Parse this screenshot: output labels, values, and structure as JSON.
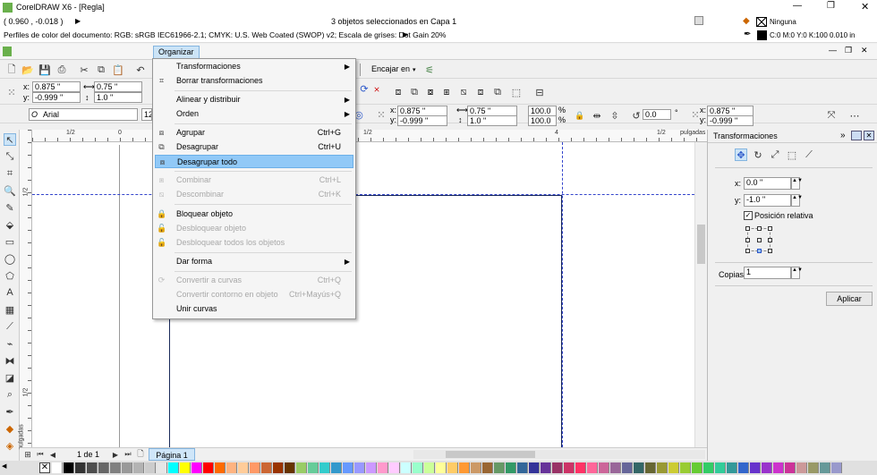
{
  "window": {
    "title": "CorelDRAW X6 - [Regla]",
    "status_center": "3 objetos seleccionados en Capa 1",
    "fill_label": "Ninguna",
    "outline_label": "C:0 M:0 Y:0 K:100  0.010 in",
    "coords": "( 0.960 , -0.018 )",
    "profiles": "Perfiles de color del documento: RGB: sRGB IEC61966-2.1; CMYK: U.S. Web Coated (SWOP) v2; Escala de grises: Dot Gain 20%"
  },
  "menubar": {
    "active_menu": "Organizar"
  },
  "toolbar": {
    "snap_label": "Encajar en"
  },
  "propbar": {
    "x": "0.875 \"",
    "y": "-0.999 \"",
    "w": "0.75 \"",
    "h": "1.0 \"",
    "x2": "0.875 \"",
    "y2": "-0.999 \"",
    "w2": "0.75 \"",
    "h2": "1.0 \"",
    "scale_w": "100.0",
    "scale_h": "100.0",
    "pct": "%",
    "angle": "0.0",
    "deg": "°",
    "x3": "0.875 \"",
    "y3": "-0.999 \""
  },
  "textbar": {
    "font": "Arial",
    "size": "12"
  },
  "menu": {
    "items": [
      {
        "label": "Transformaciones",
        "shortcut": "",
        "submenu": true,
        "disabled": false,
        "icon": ""
      },
      {
        "label": "Borrar transformaciones",
        "shortcut": "",
        "submenu": false,
        "disabled": false,
        "icon": "clear-transform-icon"
      },
      {
        "label": "Alinear y distribuir",
        "shortcut": "",
        "submenu": true,
        "disabled": false,
        "icon": ""
      },
      {
        "label": "Orden",
        "shortcut": "",
        "submenu": true,
        "disabled": false,
        "icon": ""
      },
      {
        "label": "Agrupar",
        "shortcut": "Ctrl+G",
        "submenu": false,
        "disabled": false,
        "icon": "group-icon"
      },
      {
        "label": "Desagrupar",
        "shortcut": "Ctrl+U",
        "submenu": false,
        "disabled": false,
        "icon": "ungroup-icon"
      },
      {
        "label": "Desagrupar todo",
        "shortcut": "",
        "submenu": false,
        "disabled": false,
        "icon": "ungroup-all-icon",
        "highlighted": true
      },
      {
        "label": "Combinar",
        "shortcut": "Ctrl+L",
        "submenu": false,
        "disabled": true,
        "icon": "combine-icon"
      },
      {
        "label": "Descombinar",
        "shortcut": "Ctrl+K",
        "submenu": false,
        "disabled": true,
        "icon": "break-apart-icon"
      },
      {
        "label": "Bloquear objeto",
        "shortcut": "",
        "submenu": false,
        "disabled": false,
        "icon": "lock-icon"
      },
      {
        "label": "Desbloquear objeto",
        "shortcut": "",
        "submenu": false,
        "disabled": true,
        "icon": "unlock-icon"
      },
      {
        "label": "Desbloquear todos los objetos",
        "shortcut": "",
        "submenu": false,
        "disabled": true,
        "icon": "unlock-all-icon"
      },
      {
        "label": "Dar forma",
        "shortcut": "",
        "submenu": true,
        "disabled": false,
        "icon": ""
      },
      {
        "label": "Convertir a curvas",
        "shortcut": "Ctrl+Q",
        "submenu": false,
        "disabled": true,
        "icon": "convert-curves-icon"
      },
      {
        "label": "Convertir contorno en objeto",
        "shortcut": "Ctrl+Mayús+Q",
        "submenu": false,
        "disabled": true,
        "icon": ""
      },
      {
        "label": "Unir curvas",
        "shortcut": "",
        "submenu": false,
        "disabled": false,
        "icon": ""
      }
    ]
  },
  "ruler": {
    "units": "pulgadas",
    "h_ticks": [
      "1/2",
      "0",
      "1/2",
      "4",
      "1/2"
    ],
    "v_ticks": [
      "1/2",
      "1/2"
    ]
  },
  "docker": {
    "title": "Transformaciones",
    "x_label": "x:",
    "x_value": "0.0 \"",
    "y_label": "y:",
    "y_value": "-1.0 \"",
    "relative_label": "Posición relativa",
    "copies_label": "Copias:",
    "copies_value": "1",
    "apply_label": "Aplicar"
  },
  "pagebar": {
    "page_count": "1 de 1",
    "page_tab": "Página 1"
  },
  "palette": [
    "#ffffff",
    "#000000",
    "#333333",
    "#4d4d4d",
    "#666666",
    "#808080",
    "#999999",
    "#b3b3b3",
    "#cccccc",
    "#e6e6e6",
    "#00ffff",
    "#ffff00",
    "#ff00ff",
    "#ff0000",
    "#ff6a00",
    "#ffb380",
    "#ffcc99",
    "#ff9966",
    "#cc6633",
    "#993300",
    "#663300",
    "#99cc66",
    "#66cc99",
    "#33cccc",
    "#3399cc",
    "#6699ff",
    "#9999ff",
    "#cc99ff",
    "#ff99cc",
    "#ffccff",
    "#ccffff",
    "#99ffcc",
    "#ccff99",
    "#ffff99",
    "#ffcc66",
    "#ff9933",
    "#cc9966",
    "#996633",
    "#669966",
    "#339966",
    "#336699",
    "#333399",
    "#663399",
    "#993366",
    "#cc3366",
    "#ff3366",
    "#ff6699",
    "#cc6699",
    "#996699",
    "#666699",
    "#336666",
    "#666633",
    "#999933",
    "#cccc33",
    "#99cc33",
    "#66cc33",
    "#33cc66",
    "#33cc99",
    "#339999",
    "#3366cc",
    "#6633cc",
    "#9933cc",
    "#cc33cc",
    "#cc3399",
    "#cc9999",
    "#999966",
    "#669999",
    "#9999cc"
  ]
}
